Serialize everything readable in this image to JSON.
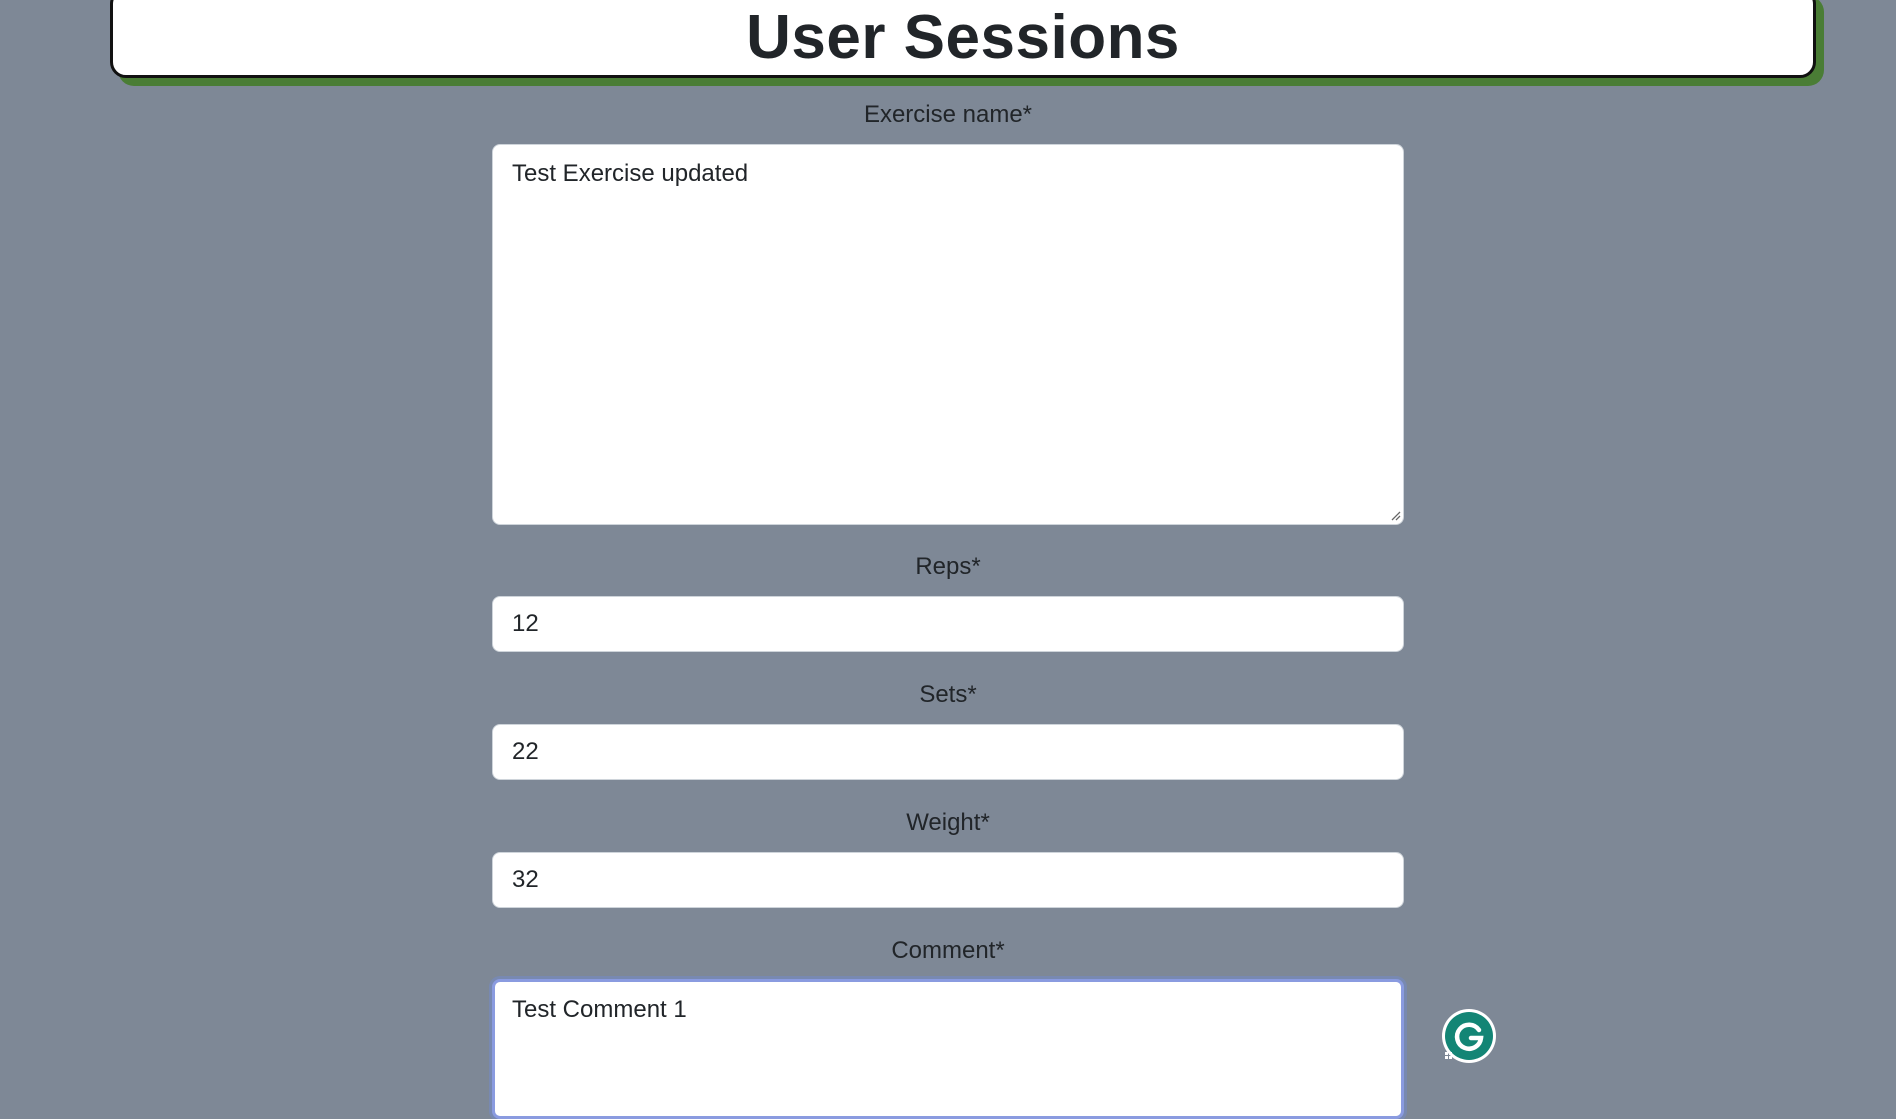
{
  "header": {
    "title": "User Sessions"
  },
  "form": {
    "exercise_name": {
      "label": "Exercise name*",
      "value": "Test Exercise updated"
    },
    "reps": {
      "label": "Reps*",
      "value": "12"
    },
    "sets": {
      "label": "Sets*",
      "value": "22"
    },
    "weight": {
      "label": "Weight*",
      "value": "32"
    },
    "comment": {
      "label": "Comment*",
      "value": "Test Comment 1"
    }
  },
  "extension": {
    "icon": "grammarly-icon",
    "color": "#138575"
  },
  "colors": {
    "page_background": "#7e8896",
    "header_shadow": "#4a7d35",
    "focus_ring": "#8a9be0"
  }
}
